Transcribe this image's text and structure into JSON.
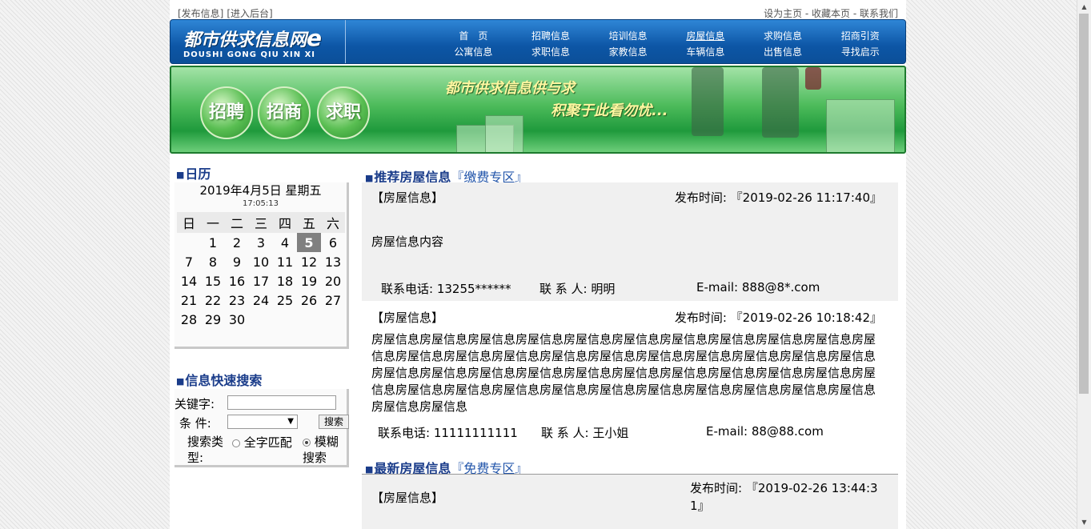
{
  "top": {
    "left_links": [
      "[发布信息]",
      "[进入后台]"
    ],
    "right_links": "设为主页 - 收藏本页 - 联系我们"
  },
  "logo": {
    "title": "都市供求信息网",
    "e": "e",
    "subtitle": "DOUSHI  GONG QIU XIN XI"
  },
  "nav": {
    "row1": [
      "首　页",
      "招聘信息",
      "培训信息",
      "房屋信息",
      "求购信息",
      "招商引资"
    ],
    "row2": [
      "公寓信息",
      "求职信息",
      "家教信息",
      "车辆信息",
      "出售信息",
      "寻找启示"
    ]
  },
  "banner": {
    "buttons": [
      "招聘",
      "招商",
      "求职"
    ],
    "slogan1": "都市供求信息供与求",
    "slogan2": "积聚于此看勿忧..."
  },
  "calendar": {
    "title": "日历",
    "date": "2019年4月5日 星期五",
    "time": "17:05:13",
    "weekdays": [
      "日",
      "一",
      "二",
      "三",
      "四",
      "五",
      "六"
    ],
    "weeks": [
      [
        "",
        "1",
        "2",
        "3",
        "4",
        "5",
        "6"
      ],
      [
        "7",
        "8",
        "9",
        "10",
        "11",
        "12",
        "13"
      ],
      [
        "14",
        "15",
        "16",
        "17",
        "18",
        "19",
        "20"
      ],
      [
        "21",
        "22",
        "23",
        "24",
        "25",
        "26",
        "27"
      ],
      [
        "28",
        "29",
        "30",
        "",
        "",
        "",
        ""
      ]
    ],
    "today": "5"
  },
  "search": {
    "title": "信息快速搜索",
    "keyword_label": "关键字:",
    "condition_label": "条  件:",
    "button": "搜索",
    "type_label": "搜索类型:",
    "opt_full": "全字匹配",
    "opt_fuzzy": "模糊搜索"
  },
  "recommended": {
    "title": "推荐房屋信息",
    "sub": "『缴费专区』",
    "posts": [
      {
        "category": "【房屋信息】",
        "pub": "发布时间: 『2019-02-26 11:17:40』",
        "body": "房屋信息内容",
        "phone": "联系电话: 13255******",
        "person": "联 系 人: 明明",
        "email": "E-mail: 888@8*.com"
      },
      {
        "category": "【房屋信息】",
        "pub": "发布时间: 『2019-02-26 10:18:42』",
        "body": "房屋信息房屋信息房屋信息房屋信息房屋信息房屋信息房屋信息房屋信息房屋信息房屋信息房屋信息房屋信息房屋信息房屋信息房屋信息房屋信息房屋信息房屋信息房屋信息房屋信息房屋信息房屋信息房屋信息房屋信息房屋信息房屋信息房屋信息房屋信息房屋信息房屋信息房屋信息房屋信息房屋信息房屋信息房屋信息房屋信息房屋信息房屋信息房屋信息房屋信息房屋信息房屋信息房屋信息房屋信息",
        "phone": "联系电话: 11111111111",
        "person": "联 系 人: 王小姐",
        "email": "E-mail: 88@88.com"
      }
    ]
  },
  "latest": {
    "title": "最新房屋信息",
    "sub": "『免费专区』",
    "posts": [
      {
        "category": "【房屋信息】",
        "pub": "发布时间: 『2019-02-26 13:44:31』"
      }
    ]
  }
}
